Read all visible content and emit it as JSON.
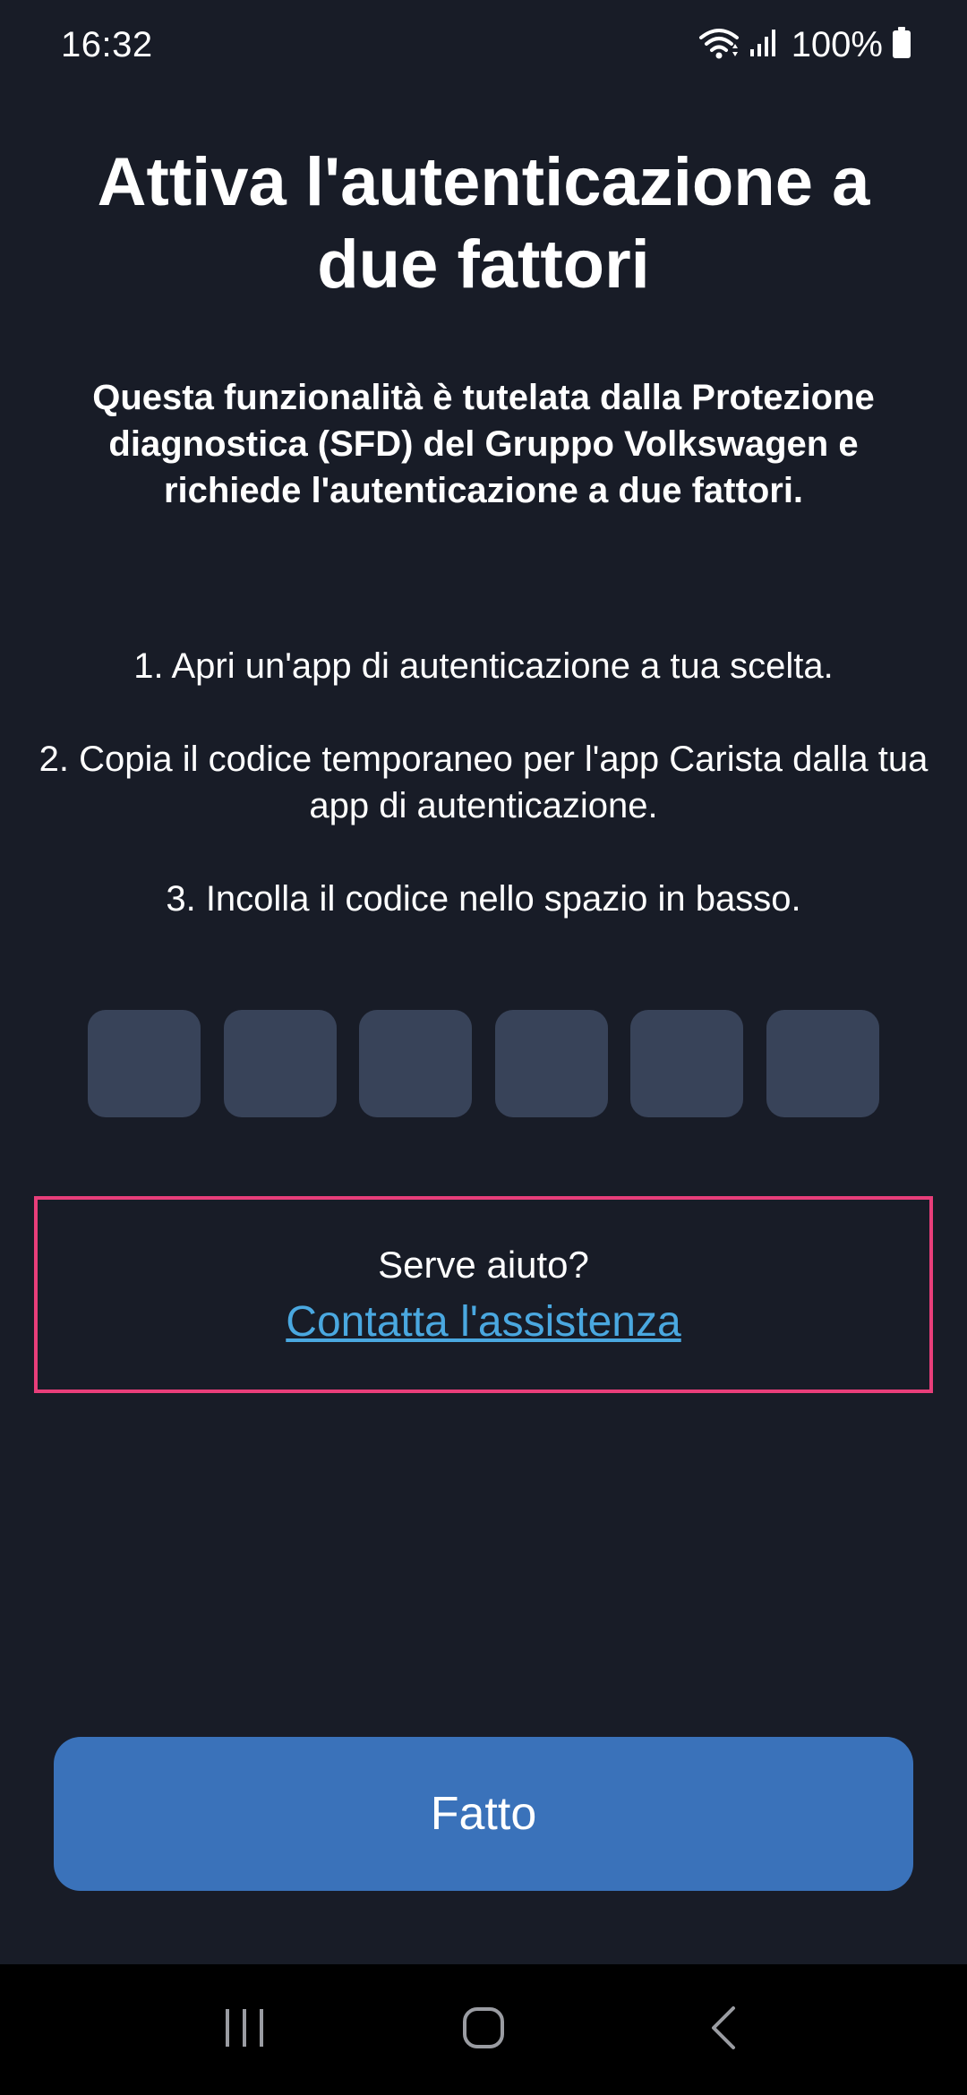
{
  "status_bar": {
    "time": "16:32",
    "battery_text": "100%",
    "icons": [
      "wifi-icon",
      "signal-icon",
      "battery-icon"
    ]
  },
  "title": "Attiva l'autenticazione a due fattori",
  "subtitle": "Questa funzionalità è tutelata dalla Protezione diagnostica (SFD) del Gruppo Volkswagen e richiede l'autenticazione a due fattori.",
  "steps": [
    "1. Apri un'app di autenticazione a tua scelta.",
    "2. Copia il codice temporaneo per l'app Carista dalla tua app di autenticazione.",
    "3. Incolla il codice nello spazio in basso."
  ],
  "code_inputs": [
    "",
    "",
    "",
    "",
    "",
    ""
  ],
  "help": {
    "question": "Serve aiuto?",
    "link_label": "Contatta l'assistenza"
  },
  "done_button": "Fatto",
  "nav_bar": {
    "icons": [
      "recent-apps-icon",
      "home-icon",
      "back-icon"
    ]
  },
  "colors": {
    "background": "#181c27",
    "input_box": "#384359",
    "link": "#4aa8e0",
    "highlight_border": "#e83e7a",
    "button": "#3a72ba"
  }
}
